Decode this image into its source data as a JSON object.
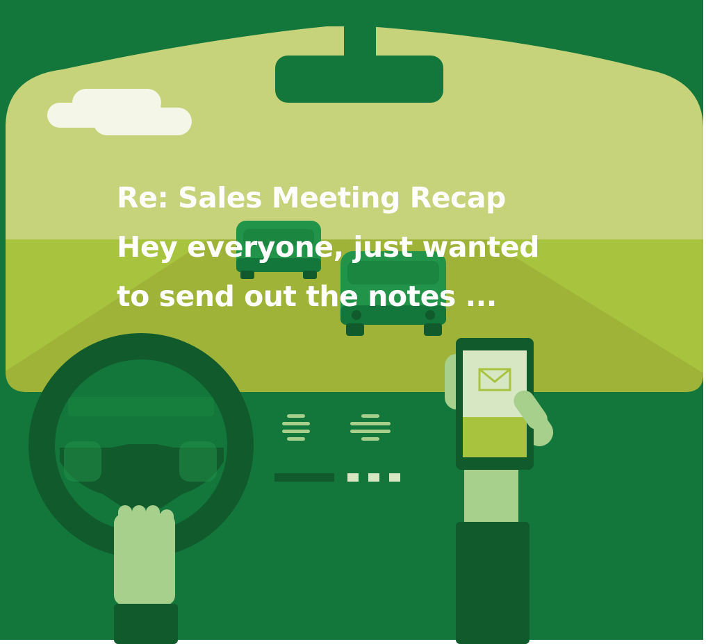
{
  "message": {
    "subject": "Re: Sales Meeting Recap",
    "preview_lines": [
      "Hey everyone, just wanted",
      "to send out the notes ..."
    ]
  },
  "colors": {
    "frame": "#13763b",
    "sky": "#c6d37a",
    "field": "#a8c43f",
    "road": "#9fb339",
    "dash": "#13763b",
    "wheel": "#105a2c",
    "car_body": "#22944a",
    "car_dark": "#13763b",
    "hand": "#a6d08c",
    "sleeve": "#105a2c",
    "cloud": "#f4f6e8",
    "phone_body": "#105a2c",
    "phone_screen_top": "#d7e7c4",
    "phone_screen_bottom": "#a8c43f",
    "overlay_text": "#ffffff"
  },
  "icons": {
    "phone_screen": "mail-envelope-icon"
  }
}
